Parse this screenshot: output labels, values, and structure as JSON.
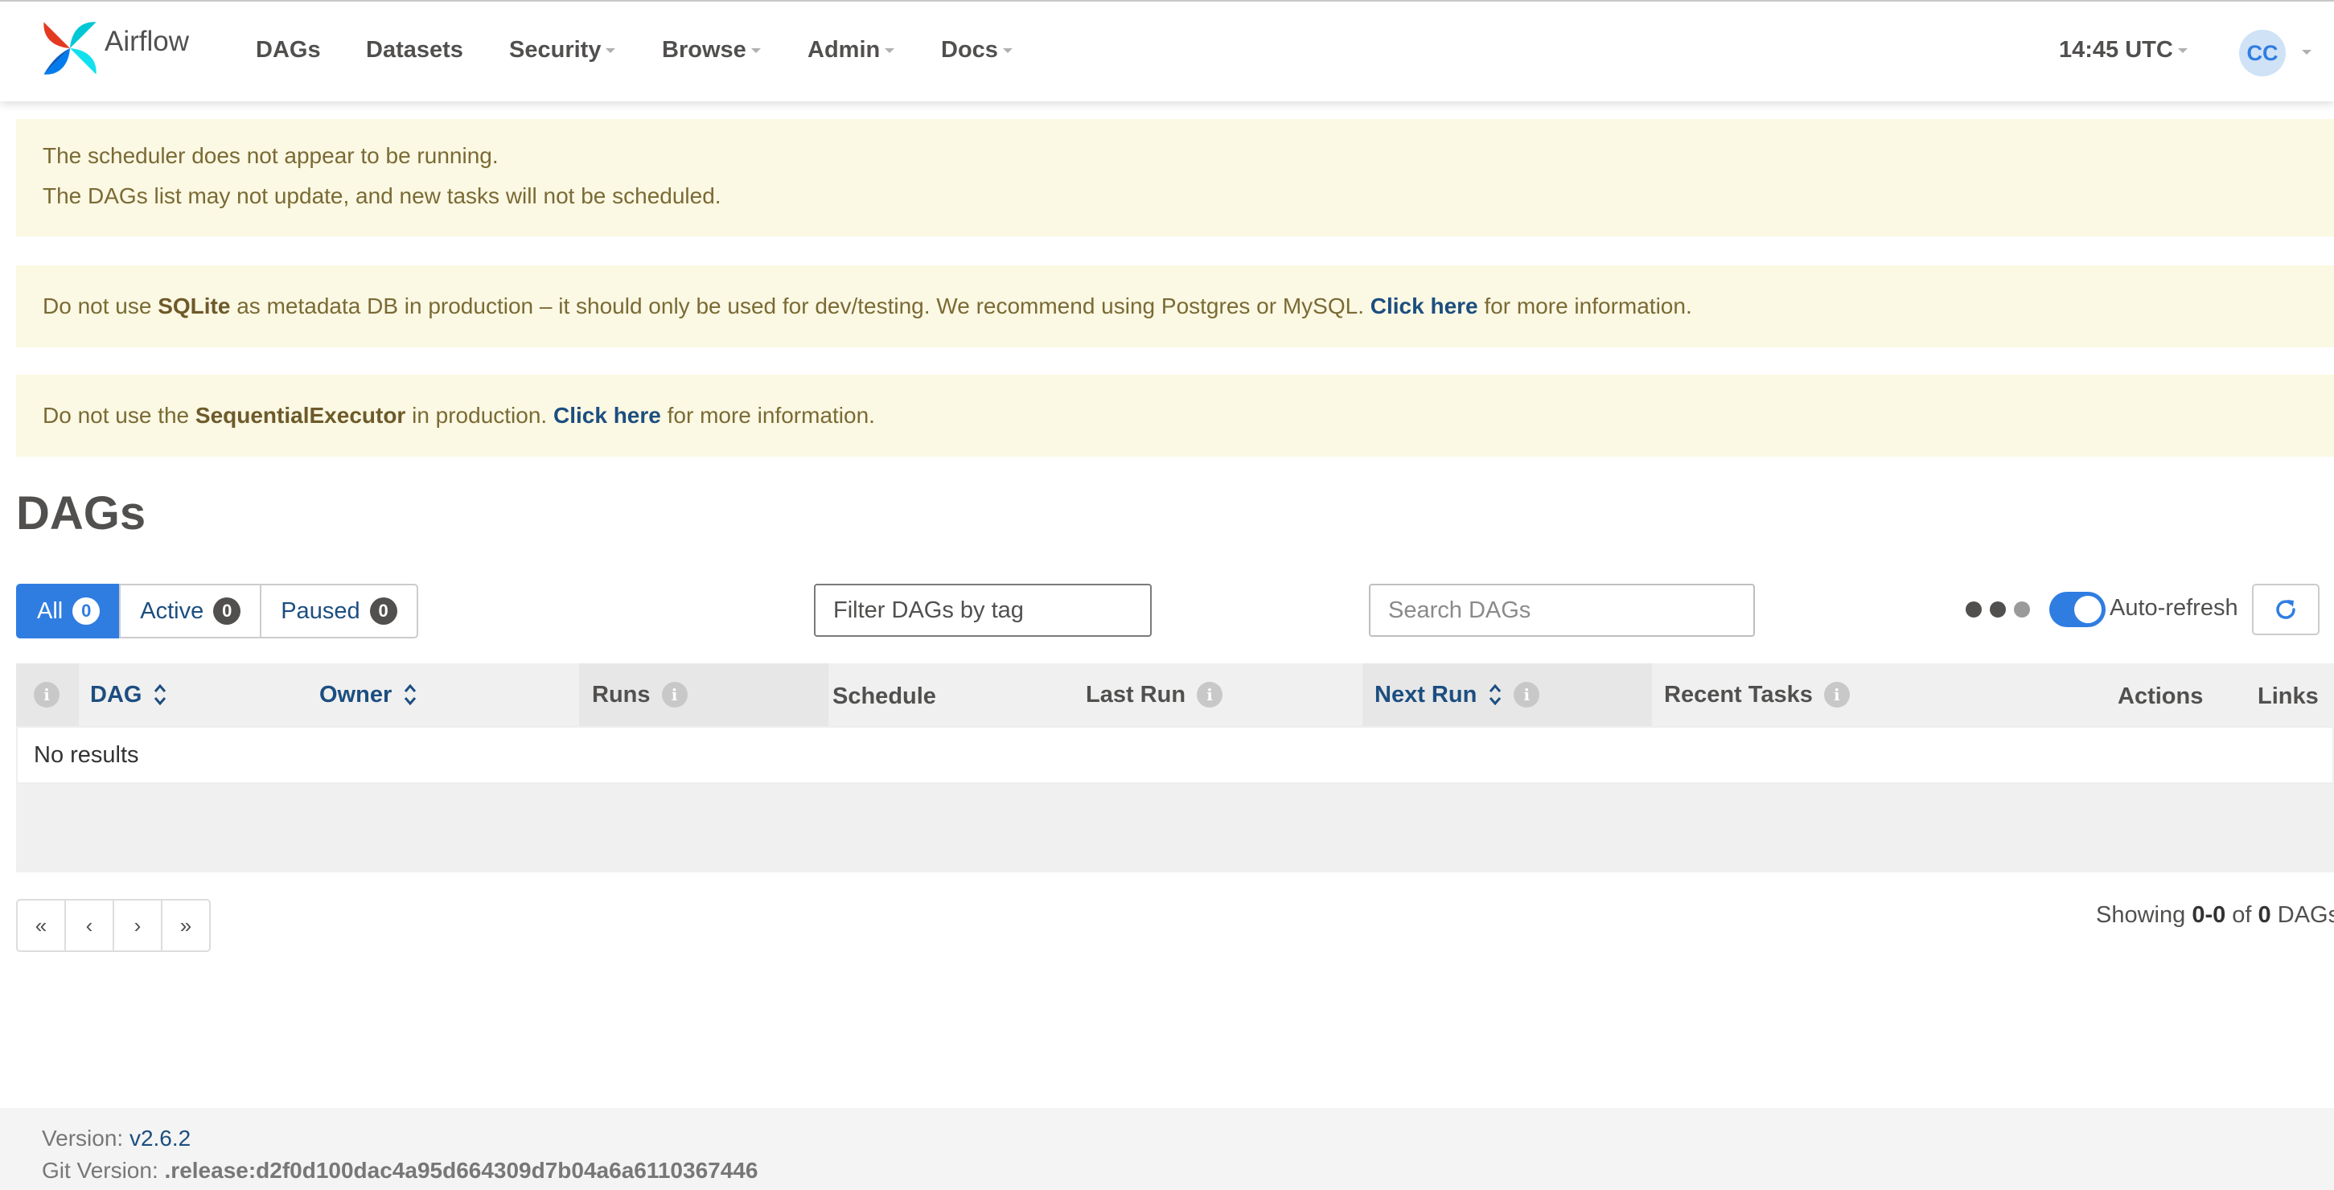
{
  "brand": {
    "name": "Airflow"
  },
  "nav": {
    "dags": "DAGs",
    "datasets": "Datasets",
    "security": "Security",
    "browse": "Browse",
    "admin": "Admin",
    "docs": "Docs"
  },
  "clock": "14:45 UTC",
  "user": {
    "initials": "CC"
  },
  "alerts": {
    "scheduler": {
      "line1": "The scheduler does not appear to be running.",
      "line2": "The DAGs list may not update, and new tasks will not be scheduled."
    },
    "sqlite": {
      "pre": "Do not use ",
      "strong": "SQLite",
      "mid": " as metadata DB in production – it should only be used for dev/testing. We recommend using Postgres or MySQL. ",
      "link": "Click here",
      "post": " for more information."
    },
    "executor": {
      "pre": "Do not use the ",
      "strong": "SequentialExecutor",
      "mid": " in production. ",
      "link": "Click here",
      "post": " for more information."
    }
  },
  "page": {
    "title": "DAGs"
  },
  "status_filter": {
    "all": {
      "label": "All",
      "count": "0"
    },
    "active": {
      "label": "Active",
      "count": "0"
    },
    "paused": {
      "label": "Paused",
      "count": "0"
    }
  },
  "tag_filter": {
    "placeholder": "Filter DAGs by tag"
  },
  "search": {
    "placeholder": "Search DAGs"
  },
  "auto_refresh": {
    "label": "Auto-refresh",
    "enabled": true
  },
  "table": {
    "columns": {
      "info": "i",
      "dag": "DAG",
      "owner": "Owner",
      "runs": "Runs",
      "schedule": "Schedule",
      "last_run": "Last Run",
      "next_run": "Next Run",
      "recent_tasks": "Recent Tasks",
      "actions": "Actions",
      "links": "Links"
    },
    "empty_message": "No results"
  },
  "pagination": {
    "first": "«",
    "prev": "‹",
    "next": "›",
    "last": "»",
    "showing_pre": "Showing ",
    "range": "0-0",
    "of": " of ",
    "total": "0",
    "suffix": " DAGs"
  },
  "footer": {
    "version_label": "Version: ",
    "version": "v2.6.2",
    "git_label": "Git Version: ",
    "git": ".release:d2f0d100dac4a95d664309d7b04a6a6110367446"
  },
  "colors": {
    "accent": "#2f7de1",
    "link": "#1c4e80",
    "alert_bg": "#fbf8e3",
    "alert_text": "#7a6a35"
  }
}
